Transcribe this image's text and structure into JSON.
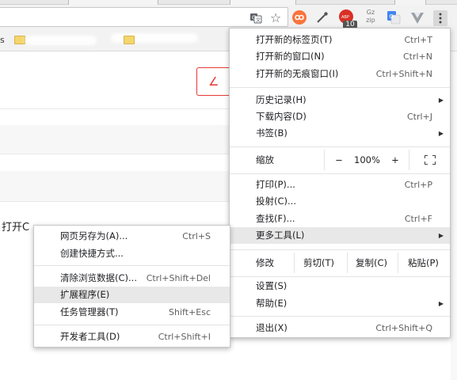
{
  "toolbar": {
    "icons": [
      "translate-icon",
      "star-icon",
      "circle-extension-icon",
      "eyedropper-icon",
      "adblock-icon",
      "gzip-icon",
      "google-translate-icon",
      "vue-devtools-icon",
      "chrome-menu-icon"
    ],
    "adblock_badge": "10",
    "gzip_label": "Gz\nzip"
  },
  "bookmarks": {
    "partial_start": "s"
  },
  "page": {
    "partial_text": "打开C",
    "edit_icon_char": "∠"
  },
  "main_menu": {
    "items": [
      {
        "label": "打开新的标签页(T)",
        "shortcut": "Ctrl+T"
      },
      {
        "label": "打开新的窗口(N)",
        "shortcut": "Ctrl+N"
      },
      {
        "label": "打开新的无痕窗口(I)",
        "shortcut": "Ctrl+Shift+N"
      },
      {
        "label": "历史记录(H)",
        "shortcut": ""
      },
      {
        "label": "下载内容(D)",
        "shortcut": "Ctrl+J"
      },
      {
        "label": "书签(B)",
        "shortcut": ""
      },
      {
        "label": "打印(P)...",
        "shortcut": "Ctrl+P"
      },
      {
        "label": "投射(C)...",
        "shortcut": ""
      },
      {
        "label": "查找(F)...",
        "shortcut": "Ctrl+F"
      },
      {
        "label": "更多工具(L)",
        "shortcut": ""
      },
      {
        "label": "设置(S)",
        "shortcut": ""
      },
      {
        "label": "帮助(E)",
        "shortcut": ""
      },
      {
        "label": "退出(X)",
        "shortcut": "Ctrl+Shift+Q"
      }
    ],
    "zoom": {
      "label": "缩放",
      "minus": "−",
      "value": "100%",
      "plus": "+"
    },
    "edit": {
      "label": "修改",
      "cut": "剪切(T)",
      "copy": "复制(C)",
      "paste": "粘贴(P)"
    }
  },
  "sub_menu": {
    "items": [
      {
        "label": "网页另存为(A)...",
        "shortcut": "Ctrl+S"
      },
      {
        "label": "创建快捷方式...",
        "shortcut": ""
      },
      {
        "label": "清除浏览数据(C)...",
        "shortcut": "Ctrl+Shift+Del"
      },
      {
        "label": "扩展程序(E)",
        "shortcut": ""
      },
      {
        "label": "任务管理器(T)",
        "shortcut": "Shift+Esc"
      },
      {
        "label": "开发者工具(D)",
        "shortcut": "Ctrl+Shift+I"
      }
    ]
  },
  "colors": {
    "menu_bg": "#ffffff",
    "menu_highlight": "#e8e8e8",
    "accent_red": "#e53935",
    "toolbar_bg": "#f2f2f2"
  }
}
